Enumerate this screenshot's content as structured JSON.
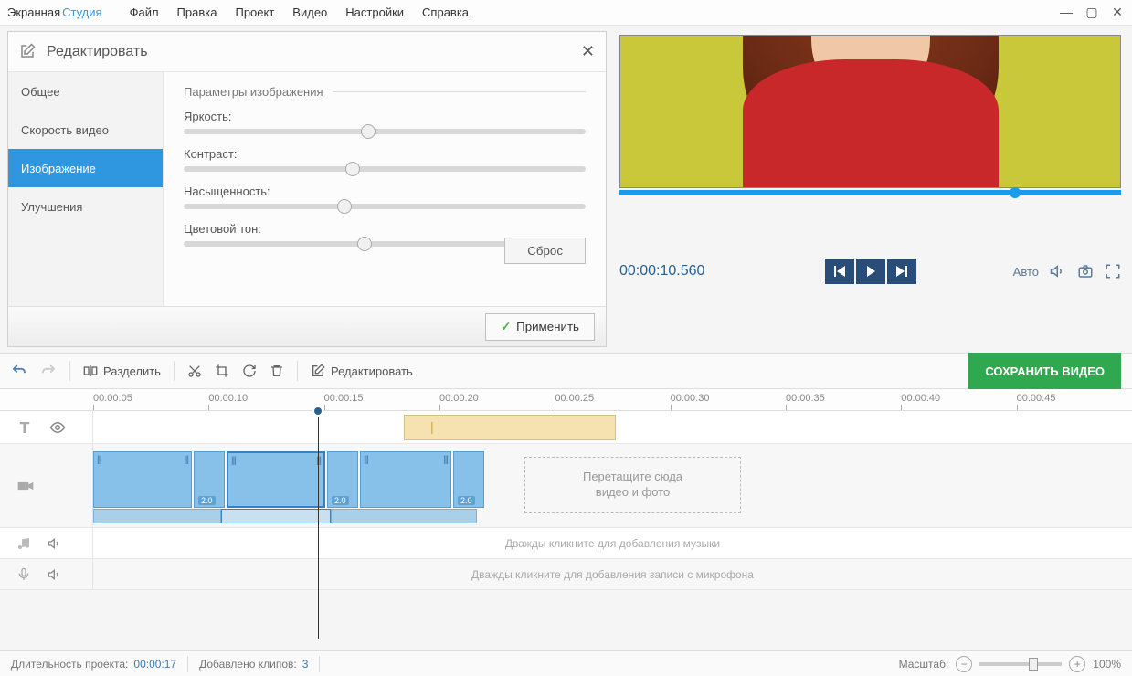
{
  "app": {
    "titleA": "Экранная",
    "titleB": "Студия"
  },
  "menu": [
    "Файл",
    "Правка",
    "Проект",
    "Видео",
    "Настройки",
    "Справка"
  ],
  "edit": {
    "title": "Редактировать",
    "tabs": [
      "Общее",
      "Скорость видео",
      "Изображение",
      "Улучшения"
    ],
    "activeTab": 2,
    "sectionTitle": "Параметры изображения",
    "sliders": [
      {
        "label": "Яркость:",
        "pos": 46
      },
      {
        "label": "Контраст:",
        "pos": 42
      },
      {
        "label": "Насыщенность:",
        "pos": 40
      },
      {
        "label": "Цветовой тон:",
        "pos": 45
      }
    ],
    "reset": "Сброс",
    "apply": "Применить"
  },
  "preview": {
    "timecode": "00:00:10.560",
    "auto": "Авто"
  },
  "toolbar": {
    "split": "Разделить",
    "editBtn": "Редактировать",
    "save": "СОХРАНИТЬ ВИДЕО"
  },
  "ruler": [
    "00:00:05",
    "00:00:10",
    "00:00:15",
    "00:00:20",
    "00:00:25",
    "00:00:30",
    "00:00:35",
    "00:00:40",
    "00:00:45"
  ],
  "tracks": {
    "dropHint1": "Перетащите сюда",
    "dropHint2": "видео и фото",
    "musicHint": "Дважды кликните для добавления музыки",
    "micHint": "Дважды кликните для добавления записи с микрофона",
    "clipDur": "2.0"
  },
  "status": {
    "durLabel": "Длительность проекта:",
    "durVal": "00:00:17",
    "clipsLabel": "Добавлено клипов:",
    "clipsVal": "3",
    "zoomLabel": "Масштаб:",
    "zoomPct": "100%"
  }
}
